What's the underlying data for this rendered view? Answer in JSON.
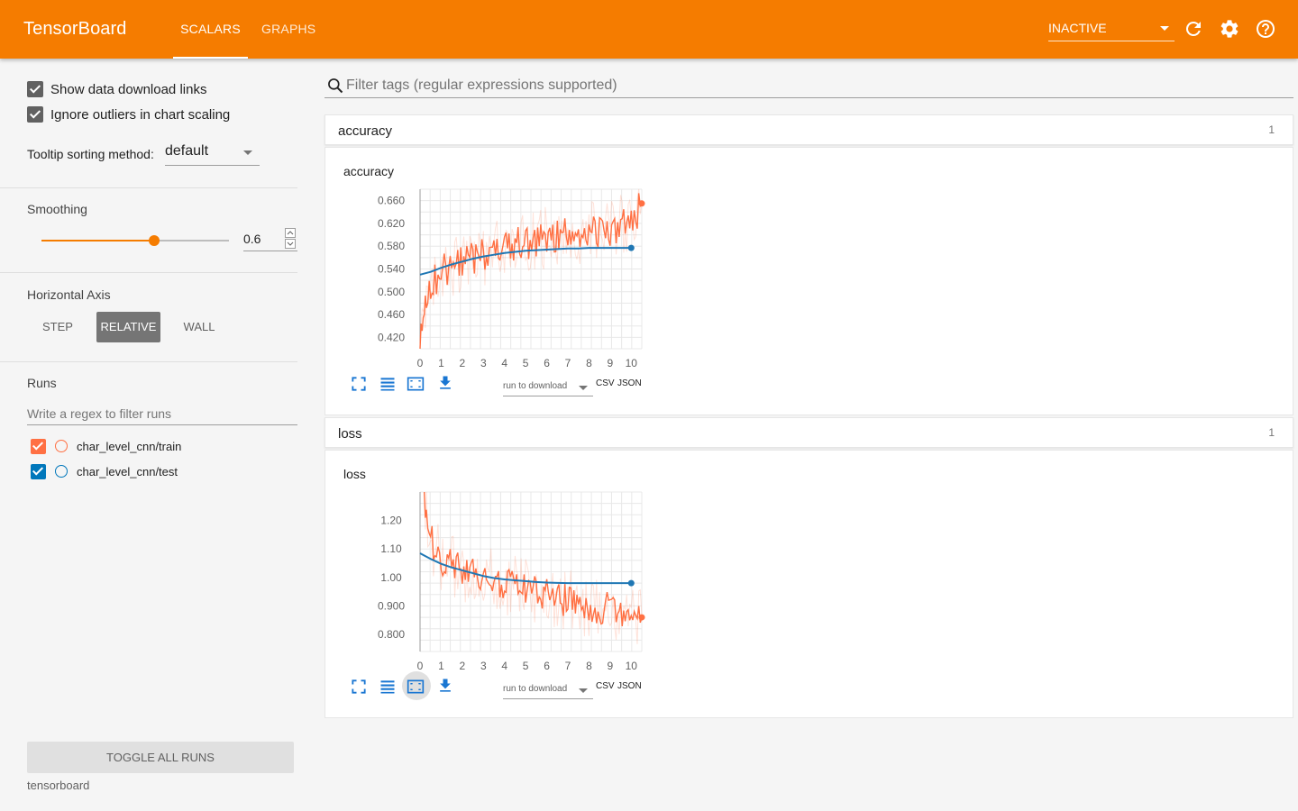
{
  "header": {
    "brand": "TensorBoard",
    "tabs": [
      {
        "label": "SCALARS"
      },
      {
        "label": "GRAPHS"
      }
    ],
    "mode": "INACTIVE",
    "icons": [
      "refresh-icon",
      "settings-icon",
      "help-icon"
    ]
  },
  "sidebar": {
    "download_links_label": "Show data download links",
    "ignore_outliers_label": "Ignore outliers in chart scaling",
    "tooltip_label": "Tooltip sorting method:",
    "tooltip_value": "default",
    "smoothing_title": "Smoothing",
    "smoothing_value": "0.6",
    "smoothing_level": 0.6,
    "haxis_title": "Horizontal Axis",
    "haxis_options": [
      {
        "label": "STEP"
      },
      {
        "label": "RELATIVE"
      },
      {
        "label": "WALL"
      }
    ],
    "haxis_selected": "RELATIVE",
    "runs_title": "Runs",
    "runs_filter_placeholder": "Write a regex to filter runs",
    "runs": [
      {
        "name": "char_level_cnn/train",
        "color": "#ff7043"
      },
      {
        "name": "char_level_cnn/test",
        "color": "#0077bb"
      }
    ],
    "toggle_all_label": "TOGGLE ALL RUNS",
    "footer_label": "tensorboard"
  },
  "main": {
    "search_placeholder": "Filter tags (regular expressions supported)",
    "categories": [
      {
        "name": "accuracy",
        "count": "1"
      },
      {
        "name": "loss",
        "count": "1"
      }
    ],
    "download_select_label": "run to download",
    "csv_label": "CSV",
    "json_label": "JSON"
  },
  "colors": {
    "accent": "#f57c00",
    "train": "#ff7043",
    "test": "#1f77b4"
  },
  "chart_data": [
    {
      "type": "line",
      "title": "accuracy",
      "x_ticks": [
        "0",
        "1",
        "2",
        "3",
        "4",
        "5",
        "6",
        "7",
        "8",
        "9",
        "10"
      ],
      "y_ticks": [
        "0.660",
        "0.620",
        "0.580",
        "0.540",
        "0.500",
        "0.460",
        "0.420"
      ],
      "xlim": [
        0,
        10.5
      ],
      "ylim": [
        0.4,
        0.68
      ],
      "series": [
        {
          "name": "char_level_cnn/train",
          "x": [
            0,
            0.1,
            0.2,
            0.3,
            0.5,
            0.7,
            1,
            1.5,
            2,
            2.5,
            3,
            3.5,
            4,
            4.5,
            5,
            5.5,
            6,
            6.5,
            7,
            7.5,
            8,
            8.5,
            9,
            9.5,
            10,
            10.5
          ],
          "values": [
            0.4,
            0.44,
            0.47,
            0.49,
            0.51,
            0.52,
            0.535,
            0.545,
            0.55,
            0.56,
            0.565,
            0.57,
            0.58,
            0.585,
            0.585,
            0.59,
            0.595,
            0.6,
            0.6,
            0.6,
            0.61,
            0.605,
            0.61,
            0.615,
            0.62,
            0.655
          ]
        },
        {
          "name": "char_level_cnn/test",
          "x": [
            0,
            0.5,
            1,
            1.5,
            2,
            2.5,
            3,
            3.5,
            4,
            4.5,
            5,
            5.5,
            6,
            6.5,
            7,
            7.5,
            8,
            8.5,
            9,
            9.5,
            10
          ],
          "values": [
            0.53,
            0.535,
            0.542,
            0.548,
            0.553,
            0.558,
            0.562,
            0.565,
            0.568,
            0.57,
            0.572,
            0.573,
            0.574,
            0.575,
            0.576,
            0.576,
            0.577,
            0.577,
            0.577,
            0.577,
            0.577
          ]
        }
      ]
    },
    {
      "type": "line",
      "title": "loss",
      "x_ticks": [
        "0",
        "1",
        "2",
        "3",
        "4",
        "5",
        "6",
        "7",
        "8",
        "9",
        "10"
      ],
      "y_ticks": [
        "1.20",
        "1.10",
        "1.00",
        "0.900",
        "0.800"
      ],
      "xlim": [
        0,
        10.5
      ],
      "ylim": [
        0.74,
        1.3
      ],
      "series": [
        {
          "name": "char_level_cnn/train",
          "x": [
            0.2,
            0.3,
            0.5,
            0.7,
            1,
            1.5,
            2,
            2.5,
            3,
            3.5,
            4,
            4.5,
            5,
            5.5,
            6,
            6.5,
            7,
            7.5,
            8,
            8.5,
            9,
            9.5,
            10,
            10.5
          ],
          "values": [
            1.3,
            1.22,
            1.14,
            1.1,
            1.06,
            1.04,
            1.02,
            1.01,
            1.0,
            0.99,
            0.98,
            0.97,
            0.96,
            0.95,
            0.94,
            0.93,
            0.92,
            0.91,
            0.9,
            0.89,
            0.89,
            0.88,
            0.87,
            0.86
          ]
        },
        {
          "name": "char_level_cnn/test",
          "x": [
            0,
            0.5,
            1,
            1.5,
            2,
            2.5,
            3,
            3.5,
            4,
            4.5,
            5,
            5.5,
            6,
            6.5,
            7,
            7.5,
            8,
            8.5,
            9,
            9.5,
            10
          ],
          "values": [
            1.085,
            1.065,
            1.048,
            1.035,
            1.025,
            1.015,
            1.005,
            0.998,
            0.993,
            0.99,
            0.987,
            0.984,
            0.982,
            0.981,
            0.98,
            0.98,
            0.98,
            0.98,
            0.98,
            0.98,
            0.98
          ]
        }
      ]
    }
  ]
}
